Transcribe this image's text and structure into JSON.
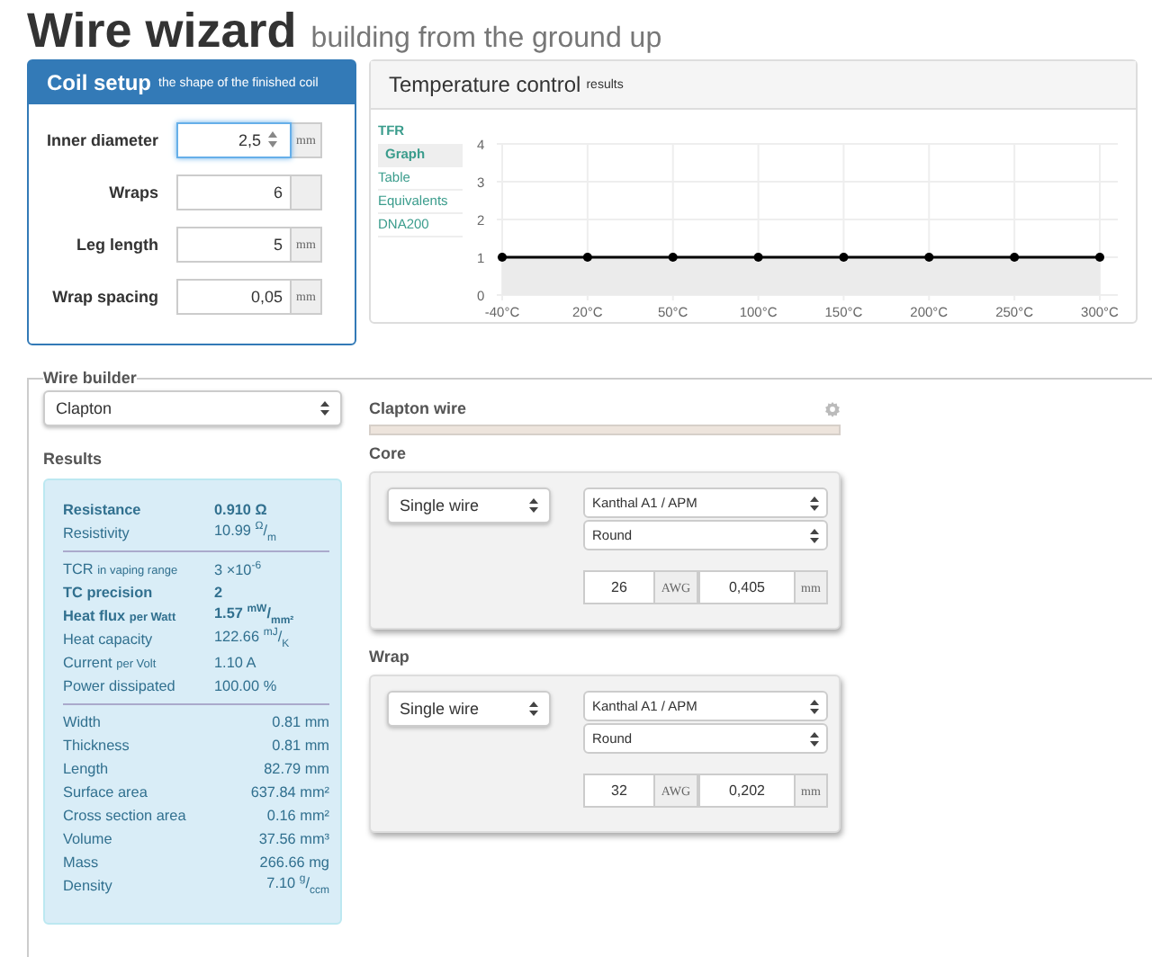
{
  "header": {
    "title": "Wire wizard",
    "subtitle": "building from the ground up"
  },
  "coil_setup": {
    "title": "Coil setup",
    "note": "the shape of the finished coil",
    "fields": [
      {
        "label": "Inner diameter",
        "value": "2,5",
        "unit": "mm",
        "focused": true
      },
      {
        "label": "Wraps",
        "value": "6",
        "focused": false
      },
      {
        "label": "Leg length",
        "value": "5",
        "unit": "mm",
        "focused": false
      },
      {
        "label": "Wrap spacing",
        "value": "0,05",
        "unit": "mm",
        "focused": false
      }
    ]
  },
  "temperature_control": {
    "title": "Temperature control",
    "note": "results",
    "heading": "TFR",
    "tabs": [
      {
        "label": "Graph",
        "selected": true
      },
      {
        "label": "Table",
        "selected": false
      },
      {
        "label": "Equivalents",
        "selected": false
      },
      {
        "label": "DNA200",
        "selected": false
      }
    ],
    "chart_data": {
      "type": "area",
      "categories": [
        "-40°C",
        "20°C",
        "50°C",
        "100°C",
        "150°C",
        "200°C",
        "250°C",
        "300°C"
      ],
      "series": [
        {
          "color": "#000000",
          "values": [
            1,
            1,
            1,
            1,
            1,
            1,
            1,
            1
          ]
        }
      ],
      "ylim": [
        0,
        4
      ],
      "yticks": [
        0,
        1,
        2,
        3,
        4
      ],
      "grid": true
    }
  },
  "wire_builder": {
    "legend": "Wire builder",
    "wire_type": "Clapton",
    "results_title": "Results",
    "results": [
      {
        "kind": "electrical",
        "rows": [
          {
            "label": "Resistance",
            "value": "0.910 Ω",
            "bold": true
          },
          {
            "label": "Resistivity",
            "value": "10.99 $^{Ω}$/$_{m}$",
            "bold": false
          }
        ]
      },
      {
        "kind": "electrical",
        "rows": [
          {
            "label": "TCR",
            "note": "in vaping range",
            "value": "3 ×10$^{-6}$",
            "bold": false
          },
          {
            "label": "TC precision",
            "value": "2",
            "bold": true
          },
          {
            "label": "Heat flux",
            "note": "per Watt",
            "value": "1.57 $^{mW}$/$_{mm²}$",
            "bold": true
          },
          {
            "label": "Heat capacity",
            "value": "122.66 $^{mJ}$/$_{K}$",
            "bold": false
          },
          {
            "label": "Current",
            "note": "per Volt",
            "value": "1.10 A",
            "bold": false
          },
          {
            "label": "Power dissipated",
            "value": "100.00 %",
            "bold": false
          }
        ]
      },
      {
        "kind": "physical",
        "rows": [
          {
            "label": "Width",
            "value": "0.81 mm",
            "bold": false
          },
          {
            "label": "Thickness",
            "value": "0.81 mm",
            "bold": false
          },
          {
            "label": "Length",
            "value": "82.79 mm",
            "bold": false
          },
          {
            "label": "Surface area",
            "value": "637.84 mm²",
            "bold": false
          },
          {
            "label": "Cross section area",
            "value": "0.16 mm²",
            "bold": false
          },
          {
            "label": "Volume",
            "value": "37.56 mm³",
            "bold": false
          },
          {
            "label": "Mass",
            "value": "266.66 mg",
            "bold": false
          },
          {
            "label": "Density",
            "value": "7.10 $^{g}$/$_{ccm}$",
            "bold": false
          }
        ]
      }
    ],
    "wire_title": "Clapton wire",
    "sections": [
      {
        "title": "Core",
        "type": "Single wire",
        "material": "Kanthal A1 / APM",
        "shape": "Round",
        "gauge": "26",
        "gauge_unit": "AWG",
        "diameter": "0,405",
        "unit": "mm"
      },
      {
        "title": "Wrap",
        "type": "Single wire",
        "material": "Kanthal A1 / APM",
        "shape": "Round",
        "gauge": "32",
        "gauge_unit": "AWG",
        "diameter": "0,202",
        "unit": "mm"
      }
    ]
  }
}
